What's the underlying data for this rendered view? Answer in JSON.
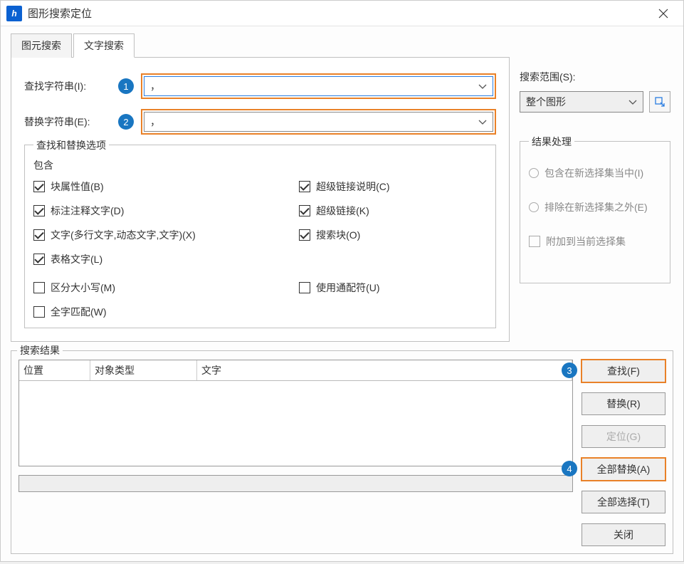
{
  "window": {
    "title": "图形搜索定位"
  },
  "tabs": {
    "primitive": "图元搜索",
    "text": "文字搜索"
  },
  "fields": {
    "find_label": "查找字符串(I):",
    "find_value": "，",
    "replace_label": "替换字符串(E):",
    "replace_value": "，"
  },
  "options_group": {
    "title": "查找和替换选项",
    "include_title": "包含",
    "block_attr": "块属性值(B)",
    "annotation": "标注注释文字(D)",
    "text_multi": "文字(多行文字,动态文字,文字)(X)",
    "table_text": "表格文字(L)",
    "hyperlink_desc": "超级链接说明(C)",
    "hyperlink": "超级链接(K)",
    "search_block": "搜索块(O)",
    "case_sensitive": "区分大小写(M)",
    "whole_word": "全字匹配(W)",
    "use_wildcard": "使用通配符(U)"
  },
  "scope": {
    "label": "搜索范围(S):",
    "value": "整个图形"
  },
  "result_handling": {
    "title": "结果处理",
    "include_sel": "包含在新选择集当中(I)",
    "exclude_sel": "排除在新选择集之外(E)",
    "append_sel": "附加到当前选择集"
  },
  "results": {
    "title": "搜索结果",
    "col_position": "位置",
    "col_type": "对象类型",
    "col_text": "文字"
  },
  "buttons": {
    "find": "查找(F)",
    "replace": "替换(R)",
    "locate": "定位(G)",
    "replace_all": "全部替换(A)",
    "select_all": "全部选择(T)",
    "close": "关闭"
  },
  "badges": {
    "b1": "1",
    "b2": "2",
    "b3": "3",
    "b4": "4"
  }
}
